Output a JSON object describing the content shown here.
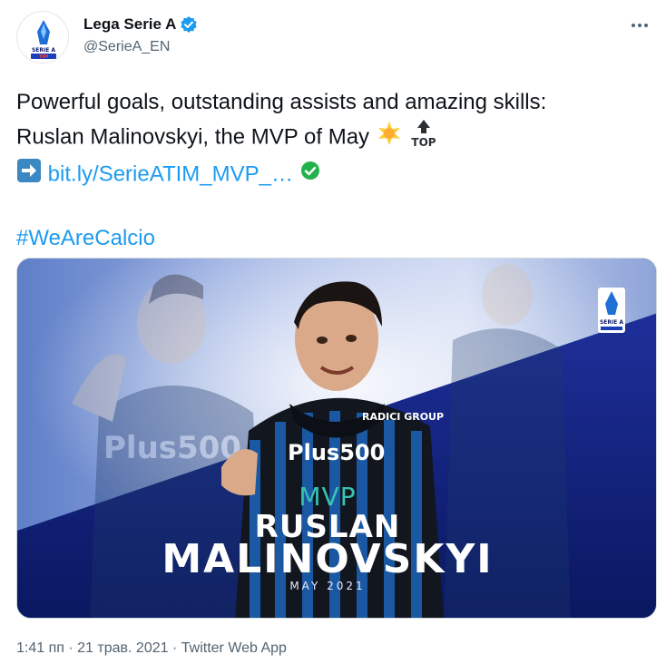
{
  "author": {
    "display_name": "Lega Serie A",
    "handle": "@SerieA_EN",
    "logo_text": [
      "SERIE A",
      "TIM"
    ],
    "verified_icon": "verified-badge-icon"
  },
  "tweet": {
    "line1": "Powerful goals, outstanding assists and amazing skills:",
    "line2": "Ruslan Malinovskyi, the MVP of May",
    "link_text": "bit.ly/SerieATIM_MVP_…",
    "hashtag": "#WeAreCalcio",
    "top_emoji_text": "TOP"
  },
  "media": {
    "mvp_label": "MVP",
    "first_name": "RUSLAN",
    "last_name": "MALINOVSKYI",
    "date": "MAY 2021",
    "sponsor": "Plus500",
    "shirt_sponsor_top": "RADICI GROUP",
    "logo_text": "SERIE A"
  },
  "footer": {
    "time": "1:41 пп",
    "date": "21 трав. 2021",
    "app": "Twitter Web App",
    "separator": "·"
  },
  "colors": {
    "link": "#1d9bf0",
    "mvp_teal": "#36c3b0",
    "navy": "#0c1a6b"
  }
}
